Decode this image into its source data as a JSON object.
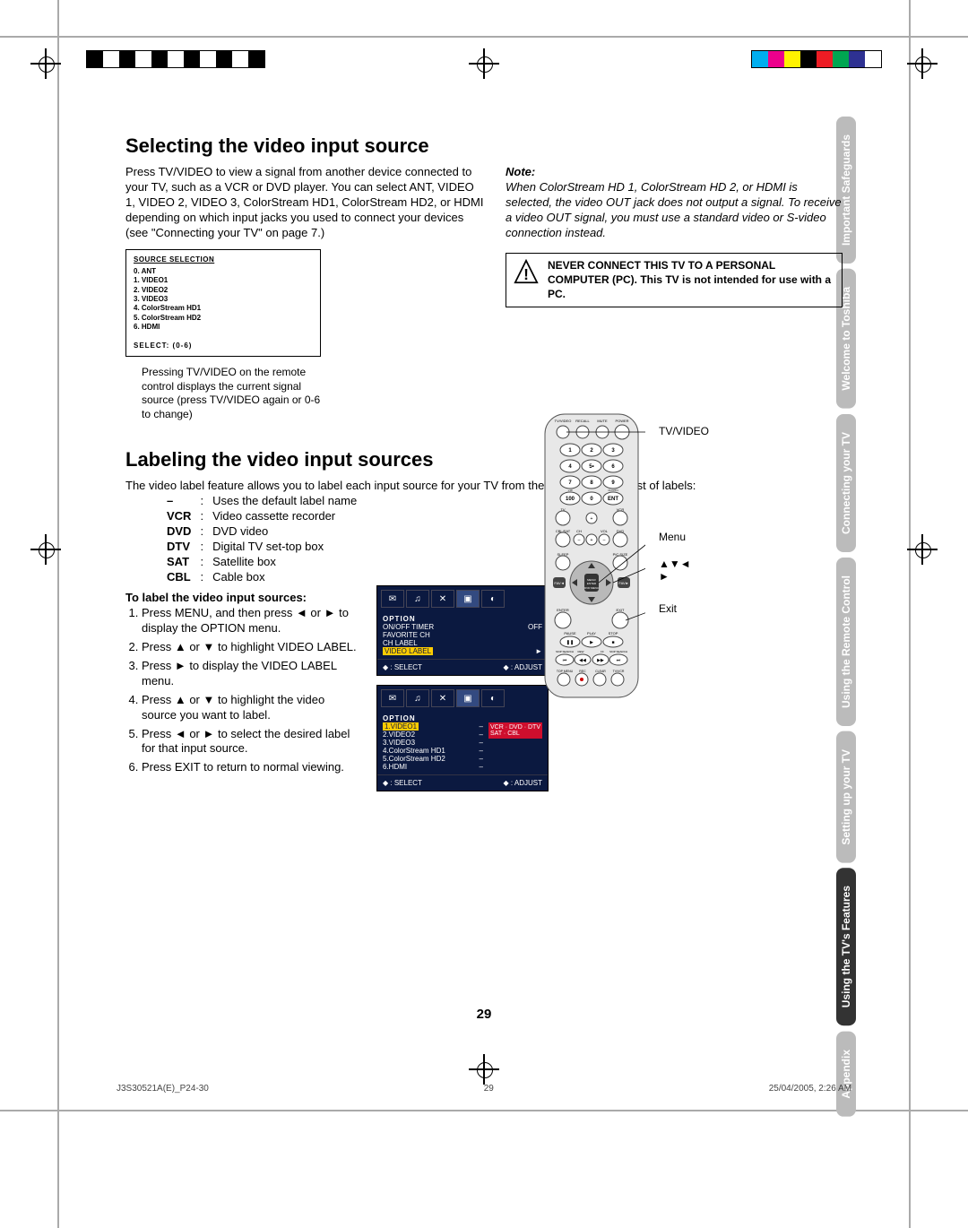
{
  "headings": {
    "selecting": "Selecting the video input source",
    "labeling": "Labeling the video input sources"
  },
  "selecting_intro": "Press TV/VIDEO to view a signal from another device connected to your TV, such as a VCR or DVD player. You can select ANT, VIDEO 1, VIDEO 2, VIDEO 3, ColorStream HD1, ColorStream HD2, or HDMI depending on which input jacks you used to connect your devices (see \"Connecting your TV\" on page 7.)",
  "source_selection": {
    "title": "SOURCE SELECTION",
    "items": [
      "0. ANT",
      "1. VIDEO1",
      "2. VIDEO2",
      "3. VIDEO3",
      "4. ColorStream HD1",
      "5. ColorStream HD2",
      "6. HDMI"
    ],
    "select": "SELECT: (0-6)"
  },
  "selecting_caption": "Pressing TV/VIDEO on the remote control displays the current signal source (press TV/VIDEO again or 0-6 to change)",
  "note": {
    "title": "Note:",
    "body": "When ColorStream HD 1, ColorStream HD 2, or HDMI is selected, the video OUT jack does not output a signal. To receive a video OUT signal, you must use a standard video or S-video connection instead."
  },
  "warning": {
    "line1": "NEVER CONNECT THIS TV TO A PERSONAL COMPUTER (PC).",
    "line2": "This TV is not intended for use with a PC."
  },
  "labeling_intro": "The video label feature allows you to label each input source for your TV from the following preset list of labels:",
  "labels": [
    {
      "code": "–",
      "desc": "Uses the default label name"
    },
    {
      "code": "VCR",
      "desc": "Video cassette recorder"
    },
    {
      "code": "DVD",
      "desc": "DVD video"
    },
    {
      "code": "DTV",
      "desc": "Digital TV set-top box"
    },
    {
      "code": "SAT",
      "desc": "Satellite box"
    },
    {
      "code": "CBL",
      "desc": "Cable box"
    }
  ],
  "instructions_title": "To label the video input sources:",
  "steps": [
    "Press MENU, and then press ◄ or ► to display the OPTION menu.",
    "Press ▲ or ▼ to highlight VIDEO LABEL.",
    "Press ► to display the VIDEO LABEL menu.",
    "Press ▲ or ▼ to highlight the video source you want to label.",
    "Press ◄ or ► to select the desired label for that input source.",
    "Press EXIT to return to normal viewing."
  ],
  "osd1": {
    "title": "OPTION",
    "rows": [
      {
        "l": "ON/OFF TIMER",
        "r": "OFF"
      },
      {
        "l": "FAVORITE CH",
        "r": ""
      },
      {
        "l": "CH LABEL",
        "r": ""
      },
      {
        "l": "VIDEO LABEL",
        "r": "►",
        "hl": true
      }
    ],
    "foot_l": "◆ : SELECT",
    "foot_r": "◆ : ADJUST"
  },
  "osd2": {
    "title": "OPTION",
    "rows": [
      {
        "l": "1.VIDEO1",
        "r": "–",
        "hl": true
      },
      {
        "l": "2.VIDEO2",
        "r": "–"
      },
      {
        "l": "3.VIDEO3",
        "r": "–"
      },
      {
        "l": "4.ColorStream   HD1",
        "r": "–"
      },
      {
        "l": "5.ColorStream   HD2",
        "r": "–"
      },
      {
        "l": "6.HDMI",
        "r": "–"
      }
    ],
    "right_labels": "VCR · DVD · DTV\nSAT · CBL",
    "foot_l": "◆ : SELECT",
    "foot_r": "◆ : ADJUST"
  },
  "remote_labels": {
    "tvvideo": "TV/VIDEO",
    "menu": "Menu",
    "arrows": "▲▼◄ ►",
    "exit": "Exit"
  },
  "side_tabs": [
    "Important Safeguards",
    "Welcome to Toshiba",
    "Connecting your TV",
    "Using the Remote Control",
    "Setting up your TV",
    "Using the TV's Features",
    "Appendix"
  ],
  "page_number": "29",
  "footer": {
    "left": "J3S30521A(E)_P24-30",
    "center": "29",
    "right": "25/04/2005, 2:26 AM"
  },
  "colorbars": [
    "#00aeef",
    "#ec008c",
    "#fff200",
    "#000000",
    "#ed1c24",
    "#00a651",
    "#2e3192",
    "#ffffff"
  ]
}
